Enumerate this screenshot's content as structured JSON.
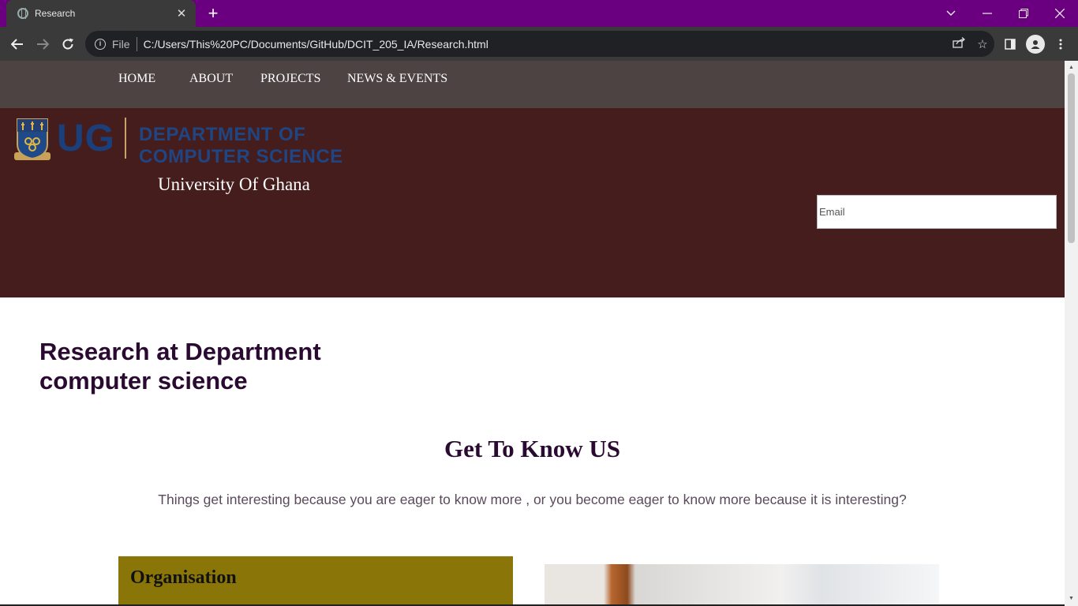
{
  "browser": {
    "tab_title": "Research",
    "tab_close": "✕",
    "new_tab": "+",
    "file_label": "File",
    "url": "C:/Users/This%20PC/Documents/GitHub/DCIT_205_IA/Research.html"
  },
  "nav": {
    "items": [
      {
        "label": "HOME"
      },
      {
        "label": "ABOUT"
      },
      {
        "label": "PROJECTS"
      },
      {
        "label": "NEWS & EVENTS"
      }
    ]
  },
  "header": {
    "logo_ug": "UG",
    "logo_dept_line1": "DEPARTMENT OF",
    "logo_dept_line2": "COMPUTER SCIENCE",
    "university": "University Of Ghana",
    "email_placeholder": "Email"
  },
  "main": {
    "research_title_line1": "Research at Department",
    "research_title_line2": "computer science",
    "know_title": "Get To Know US",
    "know_text": "Things get interesting because you are eager to know more , or you become eager to know more because it is interesting?",
    "card_title": "Organisation"
  },
  "colors": {
    "tabbar": "#6a0080",
    "site_nav": "#4d4343",
    "hero": "#451d1d",
    "heading": "#2b0a32",
    "card": "#8a7508"
  },
  "icons": {
    "back": "arrow-left-icon",
    "forward": "arrow-right-icon",
    "reload": "reload-icon",
    "share": "share-icon",
    "star": "star-icon",
    "sidebar": "side-panel-icon",
    "profile": "profile-icon",
    "menu": "kebab-menu-icon"
  }
}
